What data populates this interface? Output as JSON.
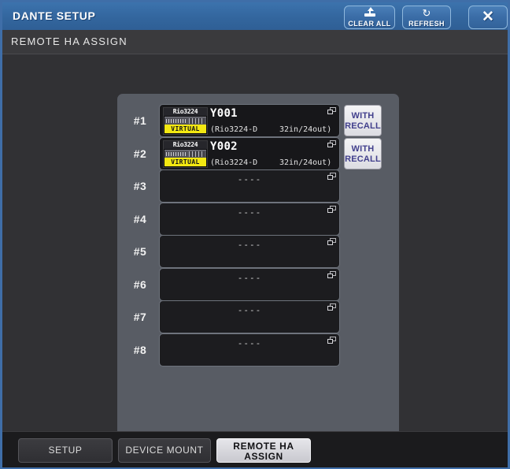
{
  "window": {
    "title": "DANTE SETUP",
    "subheader": "REMOTE HA ASSIGN"
  },
  "titlebar_buttons": {
    "clear_all": "CLEAR ALL",
    "refresh": "REFRESH",
    "close": "✕",
    "refresh_glyph": "↻"
  },
  "colors": {
    "titlebar_blue": "#33669e",
    "window_border": "#3f6ea8",
    "panel_gray": "#585c64",
    "body_bg": "#313134",
    "virtual_badge_yellow": "#f2e712",
    "recall_text_purple": "#413f8c",
    "device_slot_black": "#17171a"
  },
  "rows": [
    {
      "index": "#1",
      "empty": false,
      "thumb_title": "Rio3224",
      "virtual_badge": "VIRTUAL",
      "name": "Y001",
      "model": "(Rio3224-D",
      "io": "32in/24out)",
      "recall_line1": "WITH",
      "recall_line2": "RECALL"
    },
    {
      "index": "#2",
      "empty": false,
      "thumb_title": "Rio3224",
      "virtual_badge": "VIRTUAL",
      "name": "Y002",
      "model": "(Rio3224-D",
      "io": "32in/24out)",
      "recall_line1": "WITH",
      "recall_line2": "RECALL"
    },
    {
      "index": "#3",
      "empty": true,
      "dash": "----"
    },
    {
      "index": "#4",
      "empty": true,
      "dash": "----"
    },
    {
      "index": "#5",
      "empty": true,
      "dash": "----"
    },
    {
      "index": "#6",
      "empty": true,
      "dash": "----"
    },
    {
      "index": "#7",
      "empty": true,
      "dash": "----"
    },
    {
      "index": "#8",
      "empty": true,
      "dash": "----"
    }
  ],
  "footer_tabs": [
    {
      "id": "setup",
      "label": "SETUP",
      "active": false
    },
    {
      "id": "device-mount",
      "label": "DEVICE MOUNT",
      "active": false
    },
    {
      "id": "remote-ha-assign",
      "label_line1": "REMOTE HA",
      "label_line2": "ASSIGN",
      "active": true
    }
  ]
}
